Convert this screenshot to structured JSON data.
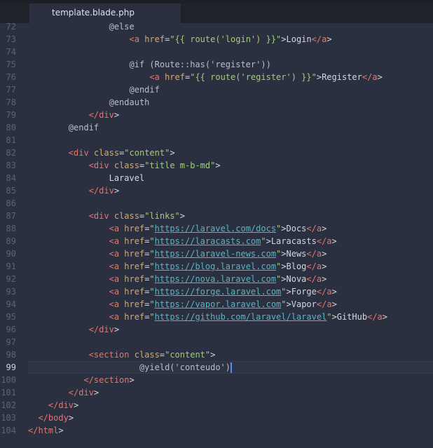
{
  "tab": {
    "title": "template.blade.php"
  },
  "lines": [
    {
      "n": "72",
      "indent": "                ",
      "tokens": [
        [
          "dir",
          "@else"
        ]
      ]
    },
    {
      "n": "73",
      "indent": "                    ",
      "tokens": [
        [
          "tag",
          "<a"
        ],
        [
          "text",
          " "
        ],
        [
          "attr",
          "href"
        ],
        [
          "text",
          "="
        ],
        [
          "str",
          "\"{{ route('login') }}\""
        ],
        [
          "text",
          ">Login"
        ],
        [
          "tag",
          "</a"
        ],
        [
          "text",
          ">"
        ]
      ]
    },
    {
      "n": "74",
      "indent": "",
      "tokens": []
    },
    {
      "n": "75",
      "indent": "                    ",
      "tokens": [
        [
          "dir",
          "@if (Route::has('register'))"
        ]
      ]
    },
    {
      "n": "76",
      "indent": "                        ",
      "tokens": [
        [
          "tag",
          "<a"
        ],
        [
          "text",
          " "
        ],
        [
          "attr",
          "href"
        ],
        [
          "text",
          "="
        ],
        [
          "str",
          "\"{{ route('register') }}\""
        ],
        [
          "text",
          ">Register"
        ],
        [
          "tag",
          "</a"
        ],
        [
          "text",
          ">"
        ]
      ]
    },
    {
      "n": "77",
      "indent": "                    ",
      "tokens": [
        [
          "dir",
          "@endif"
        ]
      ]
    },
    {
      "n": "78",
      "indent": "                ",
      "tokens": [
        [
          "dir",
          "@endauth"
        ]
      ]
    },
    {
      "n": "79",
      "indent": "            ",
      "tokens": [
        [
          "tag",
          "</div"
        ],
        [
          "text",
          ">"
        ]
      ]
    },
    {
      "n": "80",
      "indent": "        ",
      "tokens": [
        [
          "dir",
          "@endif"
        ]
      ]
    },
    {
      "n": "81",
      "indent": "",
      "tokens": []
    },
    {
      "n": "82",
      "indent": "        ",
      "tokens": [
        [
          "tag",
          "<div"
        ],
        [
          "text",
          " "
        ],
        [
          "attr",
          "class"
        ],
        [
          "text",
          "="
        ],
        [
          "str",
          "\"content\""
        ],
        [
          "text",
          ">"
        ]
      ]
    },
    {
      "n": "83",
      "indent": "            ",
      "tokens": [
        [
          "tag",
          "<div"
        ],
        [
          "text",
          " "
        ],
        [
          "attr",
          "class"
        ],
        [
          "text",
          "="
        ],
        [
          "str",
          "\"title m-b-md\""
        ],
        [
          "text",
          ">"
        ]
      ]
    },
    {
      "n": "84",
      "indent": "                ",
      "tokens": [
        [
          "text",
          "Laravel"
        ]
      ]
    },
    {
      "n": "85",
      "indent": "            ",
      "tokens": [
        [
          "tag",
          "</div"
        ],
        [
          "text",
          ">"
        ]
      ]
    },
    {
      "n": "86",
      "indent": "",
      "tokens": []
    },
    {
      "n": "87",
      "indent": "            ",
      "tokens": [
        [
          "tag",
          "<div"
        ],
        [
          "text",
          " "
        ],
        [
          "attr",
          "class"
        ],
        [
          "text",
          "="
        ],
        [
          "str",
          "\"links\""
        ],
        [
          "text",
          ">"
        ]
      ]
    },
    {
      "n": "88",
      "indent": "                ",
      "tokens": [
        [
          "tag",
          "<a"
        ],
        [
          "text",
          " "
        ],
        [
          "attr",
          "href"
        ],
        [
          "text",
          "="
        ],
        [
          "str",
          "\""
        ],
        [
          "url",
          "https://laravel.com/docs"
        ],
        [
          "str",
          "\""
        ],
        [
          "text",
          ">Docs"
        ],
        [
          "tag",
          "</a"
        ],
        [
          "text",
          ">"
        ]
      ]
    },
    {
      "n": "89",
      "indent": "                ",
      "tokens": [
        [
          "tag",
          "<a"
        ],
        [
          "text",
          " "
        ],
        [
          "attr",
          "href"
        ],
        [
          "text",
          "="
        ],
        [
          "str",
          "\""
        ],
        [
          "url",
          "https://laracasts.com"
        ],
        [
          "str",
          "\""
        ],
        [
          "text",
          ">Laracasts"
        ],
        [
          "tag",
          "</a"
        ],
        [
          "text",
          ">"
        ]
      ]
    },
    {
      "n": "90",
      "indent": "                ",
      "tokens": [
        [
          "tag",
          "<a"
        ],
        [
          "text",
          " "
        ],
        [
          "attr",
          "href"
        ],
        [
          "text",
          "="
        ],
        [
          "str",
          "\""
        ],
        [
          "url",
          "https://laravel-news.com"
        ],
        [
          "str",
          "\""
        ],
        [
          "text",
          ">News"
        ],
        [
          "tag",
          "</a"
        ],
        [
          "text",
          ">"
        ]
      ]
    },
    {
      "n": "91",
      "indent": "                ",
      "tokens": [
        [
          "tag",
          "<a"
        ],
        [
          "text",
          " "
        ],
        [
          "attr",
          "href"
        ],
        [
          "text",
          "="
        ],
        [
          "str",
          "\""
        ],
        [
          "url",
          "https://blog.laravel.com"
        ],
        [
          "str",
          "\""
        ],
        [
          "text",
          ">Blog"
        ],
        [
          "tag",
          "</a"
        ],
        [
          "text",
          ">"
        ]
      ]
    },
    {
      "n": "92",
      "indent": "                ",
      "tokens": [
        [
          "tag",
          "<a"
        ],
        [
          "text",
          " "
        ],
        [
          "attr",
          "href"
        ],
        [
          "text",
          "="
        ],
        [
          "str",
          "\""
        ],
        [
          "url",
          "https://nova.laravel.com"
        ],
        [
          "str",
          "\""
        ],
        [
          "text",
          ">Nova"
        ],
        [
          "tag",
          "</a"
        ],
        [
          "text",
          ">"
        ]
      ]
    },
    {
      "n": "93",
      "indent": "                ",
      "tokens": [
        [
          "tag",
          "<a"
        ],
        [
          "text",
          " "
        ],
        [
          "attr",
          "href"
        ],
        [
          "text",
          "="
        ],
        [
          "str",
          "\""
        ],
        [
          "url",
          "https://forge.laravel.com"
        ],
        [
          "str",
          "\""
        ],
        [
          "text",
          ">Forge"
        ],
        [
          "tag",
          "</a"
        ],
        [
          "text",
          ">"
        ]
      ]
    },
    {
      "n": "94",
      "indent": "                ",
      "tokens": [
        [
          "tag",
          "<a"
        ],
        [
          "text",
          " "
        ],
        [
          "attr",
          "href"
        ],
        [
          "text",
          "="
        ],
        [
          "str",
          "\""
        ],
        [
          "url",
          "https://vapor.laravel.com"
        ],
        [
          "str",
          "\""
        ],
        [
          "text",
          ">Vapor"
        ],
        [
          "tag",
          "</a"
        ],
        [
          "text",
          ">"
        ]
      ]
    },
    {
      "n": "95",
      "indent": "                ",
      "tokens": [
        [
          "tag",
          "<a"
        ],
        [
          "text",
          " "
        ],
        [
          "attr",
          "href"
        ],
        [
          "text",
          "="
        ],
        [
          "str",
          "\""
        ],
        [
          "url",
          "https://github.com/laravel/laravel"
        ],
        [
          "str",
          "\""
        ],
        [
          "text",
          ">GitHub"
        ],
        [
          "tag",
          "</a"
        ],
        [
          "text",
          ">"
        ]
      ]
    },
    {
      "n": "96",
      "indent": "            ",
      "tokens": [
        [
          "tag",
          "</div"
        ],
        [
          "text",
          ">"
        ]
      ]
    },
    {
      "n": "97",
      "indent": "",
      "tokens": []
    },
    {
      "n": "98",
      "indent": "            ",
      "tokens": [
        [
          "tag",
          "<section"
        ],
        [
          "text",
          " "
        ],
        [
          "attr",
          "class"
        ],
        [
          "text",
          "="
        ],
        [
          "str",
          "\"content\""
        ],
        [
          "text",
          ">"
        ]
      ]
    },
    {
      "n": "99",
      "indent": "                      ",
      "tokens": [
        [
          "dir",
          "@yield('conteudo')"
        ]
      ],
      "current": true
    },
    {
      "n": "100",
      "indent": "           ",
      "tokens": [
        [
          "tag",
          "</section"
        ],
        [
          "text",
          ">"
        ]
      ]
    },
    {
      "n": "101",
      "indent": "        ",
      "tokens": [
        [
          "tag",
          "</div"
        ],
        [
          "text",
          ">"
        ]
      ]
    },
    {
      "n": "102",
      "indent": "    ",
      "tokens": [
        [
          "tag",
          "</div"
        ],
        [
          "text",
          ">"
        ]
      ]
    },
    {
      "n": "103",
      "indent": "  ",
      "tokens": [
        [
          "tag",
          "</body"
        ],
        [
          "text",
          ">"
        ]
      ]
    },
    {
      "n": "104",
      "indent": "",
      "tokens": [
        [
          "tag",
          "</html"
        ],
        [
          "text",
          ">"
        ]
      ]
    }
  ]
}
